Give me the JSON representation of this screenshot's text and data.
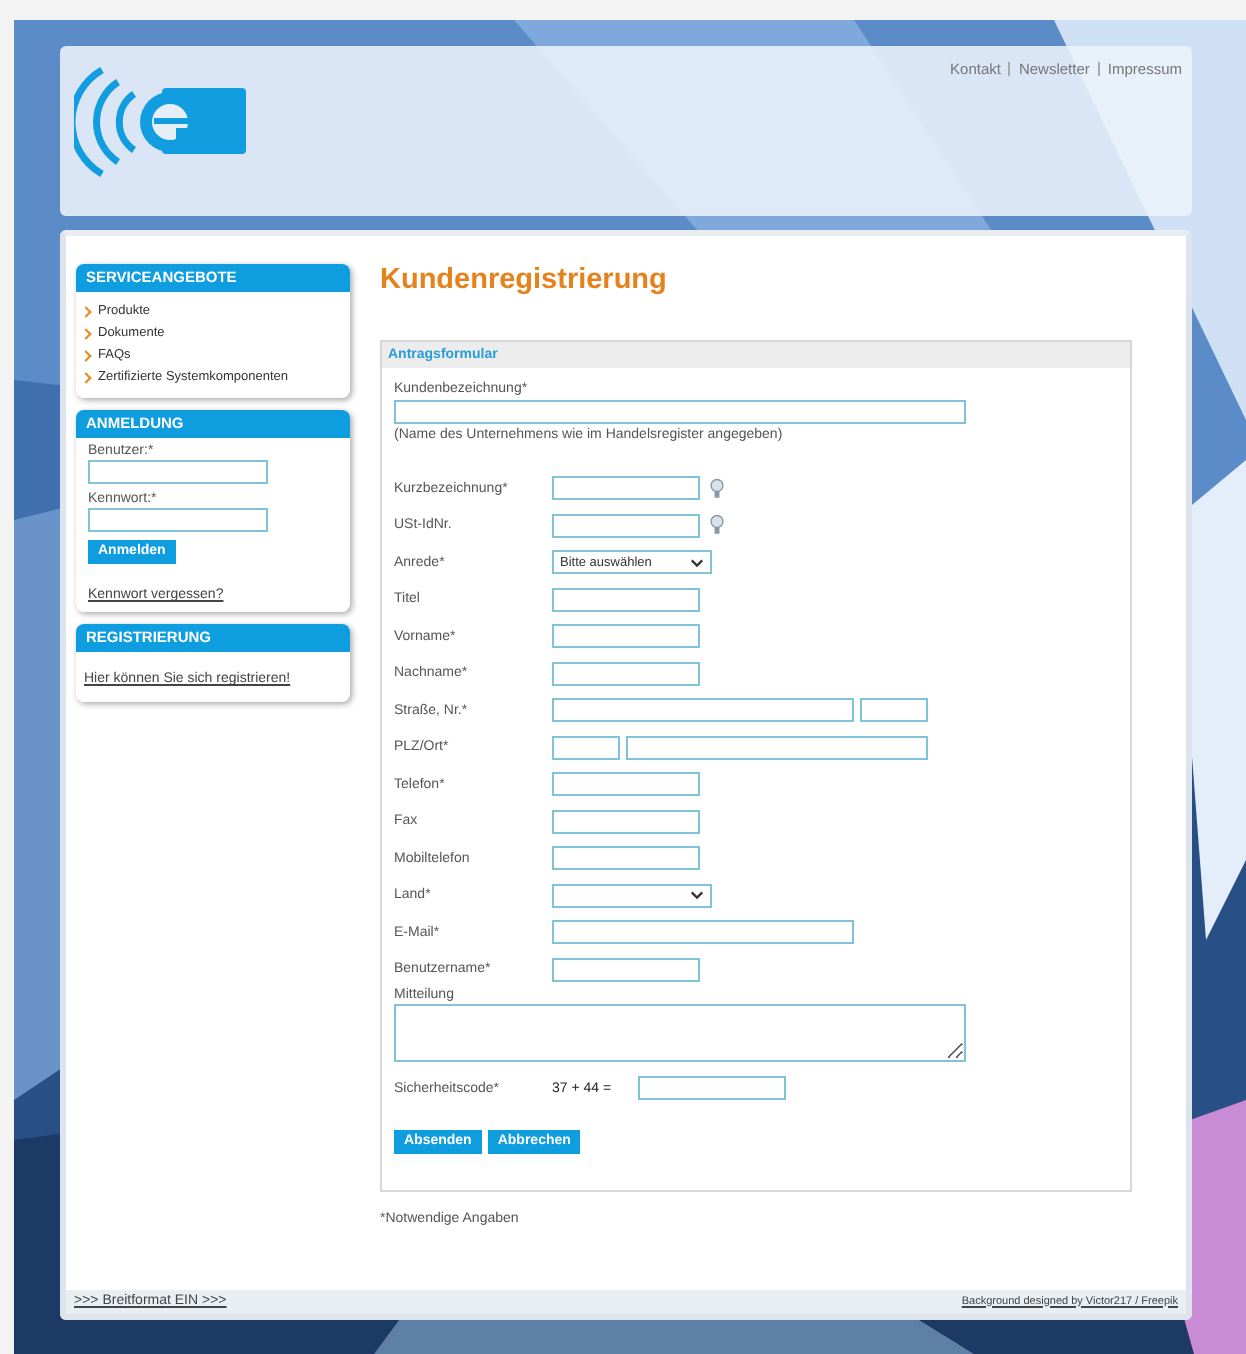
{
  "header": {
    "links": [
      "Kontakt",
      "Newsletter",
      "Impressum"
    ]
  },
  "sidebar": {
    "services": {
      "title": "SERVICEANGEBOTE",
      "items": [
        "Produkte",
        "Dokumente",
        "FAQs",
        "Zertifizierte Systemkomponenten"
      ]
    },
    "login": {
      "title": "ANMELDUNG",
      "user_label": "Benutzer:*",
      "password_label": "Kennwort:*",
      "button": "Anmelden",
      "forgot_link": "Kennwort vergessen?"
    },
    "registration": {
      "title": "REGISTRIERUNG",
      "link": "Hier können Sie sich registrieren!"
    }
  },
  "page_title": "Kundenregistrierung",
  "form": {
    "title": "Antragsformular",
    "customer_label": "Kundenbezeichnung*",
    "customer_note": "(Name des Unternehmens wie im Handelsregister angegeben)",
    "fields": [
      {
        "label": "Kurzbezeichnung*",
        "kind": "text",
        "hint": true
      },
      {
        "label": "USt-IdNr.",
        "kind": "text",
        "hint": true
      },
      {
        "label": "Anrede*",
        "kind": "select",
        "value": "Bitte auswählen"
      },
      {
        "label": "Titel",
        "kind": "text"
      },
      {
        "label": "Vorname*",
        "kind": "text"
      },
      {
        "label": "Nachname*",
        "kind": "text"
      },
      {
        "label": "Straße, Nr.*",
        "kind": "street"
      },
      {
        "label": "PLZ/Ort*",
        "kind": "zip-city"
      },
      {
        "label": "Telefon*",
        "kind": "text"
      },
      {
        "label": "Fax",
        "kind": "text"
      },
      {
        "label": "Mobiltelefon",
        "kind": "text"
      },
      {
        "label": "Land*",
        "kind": "select"
      },
      {
        "label": "E-Mail*",
        "kind": "wide"
      },
      {
        "label": "Benutzername*",
        "kind": "text"
      }
    ],
    "message_label": "Mitteilung",
    "captcha_label": "Sicherheitscode*",
    "captcha_question": "37 + 44 =",
    "buttons": [
      "Absenden",
      "Abbrechen"
    ]
  },
  "required_note": "*Notwendige Angaben",
  "footer": {
    "wide_link": ">>> Breitformat EIN >>>",
    "credit_link": "Background designed by Victor217 / Freepik"
  }
}
